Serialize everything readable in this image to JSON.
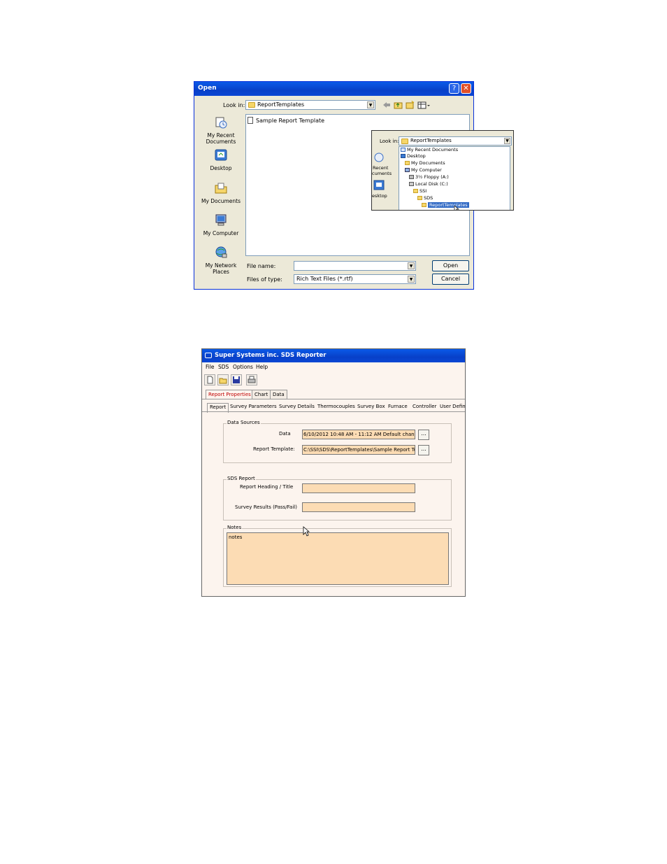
{
  "open_dialog": {
    "title": "Open",
    "help": "?",
    "close": "✕",
    "look_in_label": "Look in:",
    "look_in_value": "ReportTemplates",
    "places": [
      {
        "label": "My Recent Documents",
        "icon": "recent-documents-icon"
      },
      {
        "label": "Desktop",
        "icon": "desktop-icon"
      },
      {
        "label": "My Documents",
        "icon": "my-documents-icon"
      },
      {
        "label": "My Computer",
        "icon": "my-computer-icon"
      },
      {
        "label": "My Network Places",
        "icon": "network-places-icon"
      }
    ],
    "files": [
      "Sample Report Template"
    ],
    "file_name_label": "File name:",
    "file_name_value": "",
    "files_of_type_label": "Files of type:",
    "files_of_type_value": "Rich Text Files (*.rtf)",
    "open_button": "Open",
    "cancel_button": "Cancel"
  },
  "lookin_overlay": {
    "look_in_label": "Look in:",
    "look_in_value": "ReportTemplates",
    "places_partial": [
      "Recent",
      "cuments",
      "esktop"
    ],
    "tree": [
      "My Recent Documents",
      "Desktop",
      "My Documents",
      "My Computer",
      "3½ Floppy (A:)",
      "Local Disk (C:)",
      "SSI",
      "SDS",
      "ReportTemplates"
    ]
  },
  "reporter": {
    "title": "Super Systems inc. SDS Reporter",
    "menu": [
      "File",
      "SDS",
      "Options",
      "Help"
    ],
    "toolbar": [
      "new-icon",
      "open-folder-icon",
      "save-icon",
      "print-icon"
    ],
    "tabs": [
      "Report Properties",
      "Chart",
      "Data"
    ],
    "subtabs": [
      "Report",
      "Survey Parameters",
      "Survey Details",
      "Thermocouples",
      "Survey Box",
      "Furnace",
      "Controller",
      "User Defin"
    ],
    "data_sources": {
      "title": "Data Sources",
      "data_label": "Data",
      "data_value": "6/10/2012 10:48 AM - 11:12 AM  Default change",
      "template_label": "Report Template:",
      "template_value": "C:\\SSI\\SDS\\ReportTemplates\\Sample Report Tem",
      "browse": "..."
    },
    "sds_report": {
      "title": "SDS Report",
      "heading_label": "Report Heading / Title",
      "heading_value": "",
      "results_label": "Survey Results (Pass/Fail)",
      "results_value": ""
    },
    "notes": {
      "title": "Notes",
      "value": "notes"
    }
  }
}
